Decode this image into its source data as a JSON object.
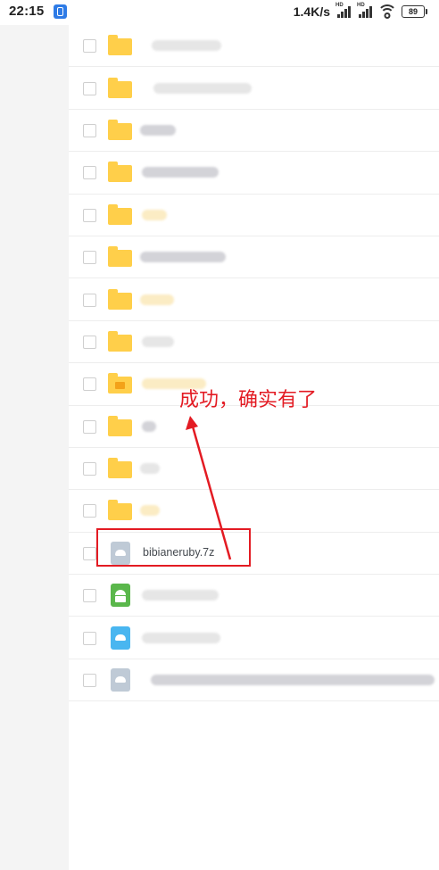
{
  "status_bar": {
    "time": "22:15",
    "net_speed": "1.4K/s",
    "signal_label_1": "HD",
    "signal_label_2": "HD",
    "battery": "89"
  },
  "files": [
    {
      "type": "folder"
    },
    {
      "type": "folder"
    },
    {
      "type": "folder"
    },
    {
      "type": "folder"
    },
    {
      "type": "folder"
    },
    {
      "type": "folder"
    },
    {
      "type": "folder"
    },
    {
      "type": "folder"
    },
    {
      "type": "folder-briefcase"
    },
    {
      "type": "folder"
    },
    {
      "type": "folder"
    },
    {
      "type": "folder"
    },
    {
      "type": "archive",
      "name": "bibianeruby.7z"
    },
    {
      "type": "apk"
    },
    {
      "type": "image"
    },
    {
      "type": "archive"
    }
  ],
  "annotation": {
    "text": "成功，确实有了",
    "color": "#e31b23"
  },
  "colors": {
    "folder": "#ffcf4a",
    "accent": "#e31b23"
  }
}
